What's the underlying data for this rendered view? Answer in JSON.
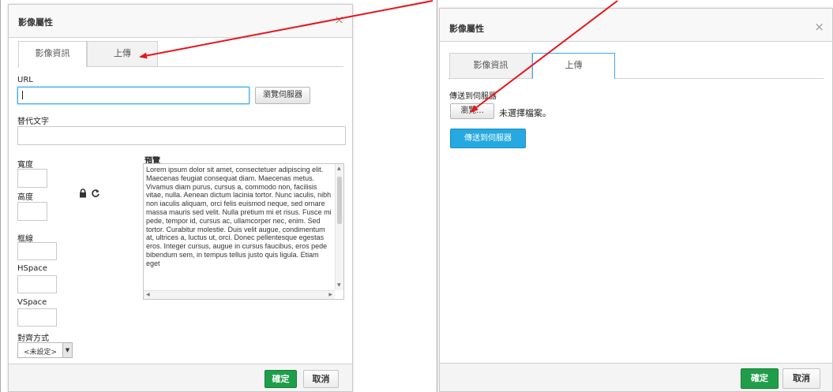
{
  "left_dialog": {
    "title": "影像屬性",
    "close": "×",
    "tabs": [
      {
        "label": "影像資訊",
        "active": true
      },
      {
        "label": "上傳",
        "active": false
      }
    ],
    "url_label": "URL",
    "url_value": "",
    "browse_server_label": "瀏覽伺服器",
    "alt_label": "替代文字",
    "width_label": "寬度",
    "height_label": "高度",
    "border_label": "框線",
    "hspace_label": "HSpace",
    "vspace_label": "VSpace",
    "align_label": "對齊方式",
    "align_selected": "<未設定>",
    "lock_icon": "lock-icon",
    "reset_icon": "reset-icon",
    "preview_label": "預覽",
    "preview_text": "Lorem ipsum dolor sit amet, consectetuer adipiscing elit. Maecenas feugiat consequat diam. Maecenas metus. Vivamus diam purus, cursus a, commodo non, facilisis vitae, nulla. Aenean dictum lacinia tortor. Nunc iaculis, nibh non iaculis aliquam, orci felis euismod neque, sed ornare massa mauris sed velit. Nulla pretium mi et risus. Fusce mi pede, tempor id, cursus ac, ullamcorper nec, enim. Sed tortor. Curabitur molestie. Duis velit augue, condimentum at, ultrices a, luctus ut, orci. Donec pellentesque egestas eros. Integer cursus, augue in cursus faucibus, eros pede bibendum sem, in tempus tellus justo quis ligula. Etiam eget",
    "ok_label": "確定",
    "cancel_label": "取消"
  },
  "right_dialog": {
    "title": "影像屬性",
    "close": "×",
    "tabs": [
      {
        "label": "影像資訊",
        "active": false
      },
      {
        "label": "上傳",
        "active": true
      }
    ],
    "send_label": "傳送到伺服器",
    "file_button_label": "瀏覽...",
    "file_status": "未選擇檔案。",
    "upload_button_label": "傳送到伺服器",
    "ok_label": "確定",
    "cancel_label": "取消"
  },
  "colors": {
    "annotation_arrow": "#e8141b",
    "ok_green": "#1f9e4a",
    "upload_blue": "#25a9e0",
    "focus_blue": "#3fa9f5"
  }
}
